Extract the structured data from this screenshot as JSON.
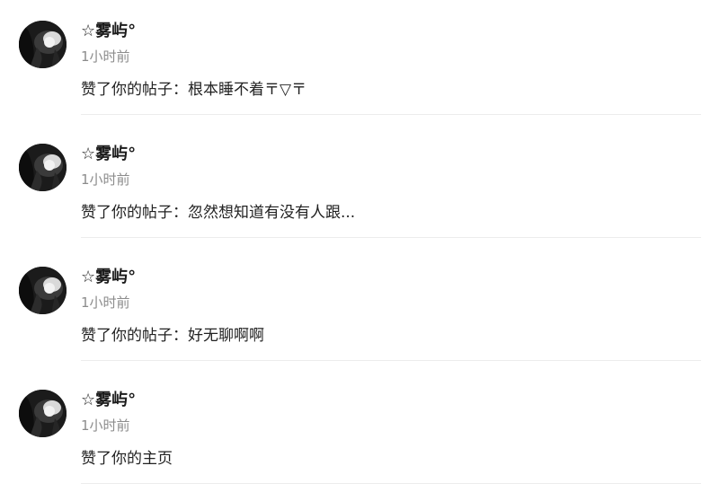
{
  "notifications": [
    {
      "username": "☆雾屿°",
      "time": "1小时前",
      "action": "赞了你的帖子：根本睡不着〒▽〒",
      "avatar_icon": "user-avatar"
    },
    {
      "username": "☆雾屿°",
      "time": "1小时前",
      "action": "赞了你的帖子：忽然想知道有没有人跟...",
      "avatar_icon": "user-avatar"
    },
    {
      "username": "☆雾屿°",
      "time": "1小时前",
      "action": "赞了你的帖子：好无聊啊啊",
      "avatar_icon": "user-avatar"
    },
    {
      "username": "☆雾屿°",
      "time": "1小时前",
      "action": "赞了你的主页",
      "avatar_icon": "user-avatar"
    }
  ],
  "colors": {
    "username": "#1a1a1a",
    "time": "#8c8c8c",
    "action": "#222222",
    "divider": "#ececec",
    "avatar_bg": "#1b1b1b"
  }
}
